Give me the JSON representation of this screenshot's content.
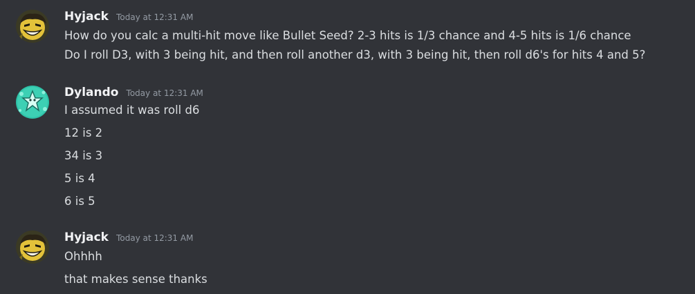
{
  "messages": [
    {
      "author": "Hyjack",
      "timestamp": "Today at 12:31 AM",
      "avatar": "yellow-grinning-character-avatar",
      "lines": [
        "How do you calc a multi-hit move like Bullet Seed? 2-3 hits is 1/3 chance and 4-5 hits is 1/6 chance",
        "Do I roll D3, with 3 being hit, and then roll another d3, with 3 being hit, then roll d6's for hits 4 and 5?"
      ]
    },
    {
      "author": "Dylando",
      "timestamp": "Today at 12:31 AM",
      "avatar": "teal-star-creature-avatar",
      "lines": [
        "I assumed it was roll d6",
        "12 is 2",
        "34 is 3",
        "5 is 4",
        "6 is 5"
      ]
    },
    {
      "author": "Hyjack",
      "timestamp": "Today at 12:31 AM",
      "avatar": "yellow-grinning-character-avatar",
      "lines": [
        "Ohhhh",
        "that makes sense thanks"
      ]
    }
  ],
  "colors": {
    "background": "#313338",
    "username": "#f2f3f5",
    "timestamp": "#949ba4",
    "message_text": "#dbdee1"
  }
}
